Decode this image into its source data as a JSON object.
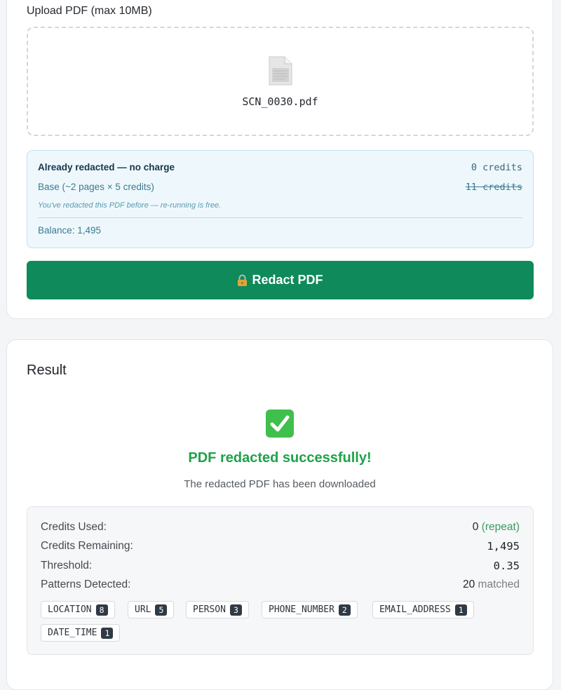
{
  "upload": {
    "label": "Upload PDF (max 10MB)",
    "file_icon": "document-icon",
    "file_name": "SCN_0030.pdf"
  },
  "cost": {
    "title": "Already redacted — no charge",
    "title_value": "0 credits",
    "base_label": "Base (~2 pages × 5 credits)",
    "base_value": "11 credits",
    "note": "You've redacted this PDF before — re-running is free.",
    "balance": "Balance: 1,495"
  },
  "redact_button": {
    "icon": "lock-icon",
    "label": "Redact PDF"
  },
  "result": {
    "title": "Result",
    "icon": "check-mark-icon",
    "success_title": "PDF redacted successfully!",
    "success_sub": "The redacted PDF has been downloaded",
    "stats": {
      "credits_used_label": "Credits Used:",
      "credits_used_value": "0",
      "credits_used_suffix": "(repeat)",
      "credits_remaining_label": "Credits Remaining:",
      "credits_remaining_value": "1,495",
      "threshold_label": "Threshold:",
      "threshold_value": "0.35",
      "patterns_label": "Patterns Detected:",
      "patterns_value": "20",
      "patterns_suffix": "matched"
    },
    "tags": [
      {
        "name": "LOCATION",
        "count": "8"
      },
      {
        "name": "URL",
        "count": "5"
      },
      {
        "name": "PERSON",
        "count": "3"
      },
      {
        "name": "PHONE_NUMBER",
        "count": "2"
      },
      {
        "name": "EMAIL_ADDRESS",
        "count": "1"
      },
      {
        "name": "DATE_TIME",
        "count": "1"
      }
    ]
  },
  "colors": {
    "accent_green": "#0f8a5a",
    "success_green": "#1fa24a",
    "info_bg": "#eef8fc"
  }
}
